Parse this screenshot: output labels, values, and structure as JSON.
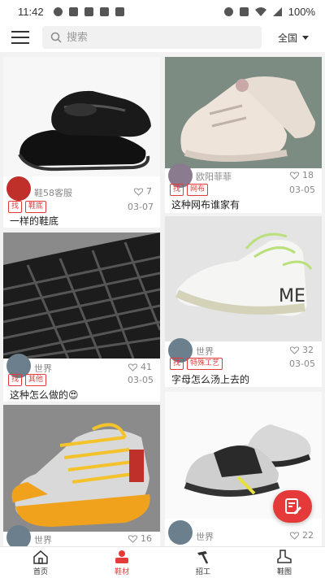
{
  "status_bar": {
    "time": "11:42",
    "battery": "100%"
  },
  "header": {
    "search_placeholder": "搜索",
    "region": "全国"
  },
  "feed": [
    {
      "author": "鞋58客服",
      "likes": "7",
      "tags": [
        "找",
        "鞋底"
      ],
      "date": "03-07",
      "title": "一样的鞋底"
    },
    {
      "author": "欧阳菲菲",
      "likes": "18",
      "tags": [
        "找",
        "网布"
      ],
      "date": "03-05",
      "title": "这种网布谁家有"
    },
    {
      "author": "世界",
      "likes": "41",
      "tags": [
        "找",
        "其他"
      ],
      "date": "03-05",
      "title": "这种怎么做的😍"
    },
    {
      "author": "世界",
      "likes": "32",
      "tags": [
        "找",
        "特殊工艺"
      ],
      "date": "03-05",
      "title": "字母怎么汤上去的"
    },
    {
      "author": "世界",
      "likes": "16"
    },
    {
      "author": "世界",
      "likes": "22"
    }
  ],
  "tabbar": [
    {
      "label": "首页"
    },
    {
      "label": "鞋材"
    },
    {
      "label": "招工"
    },
    {
      "label": "鞋图"
    }
  ],
  "colors": {
    "accent": "#e53a3a"
  }
}
